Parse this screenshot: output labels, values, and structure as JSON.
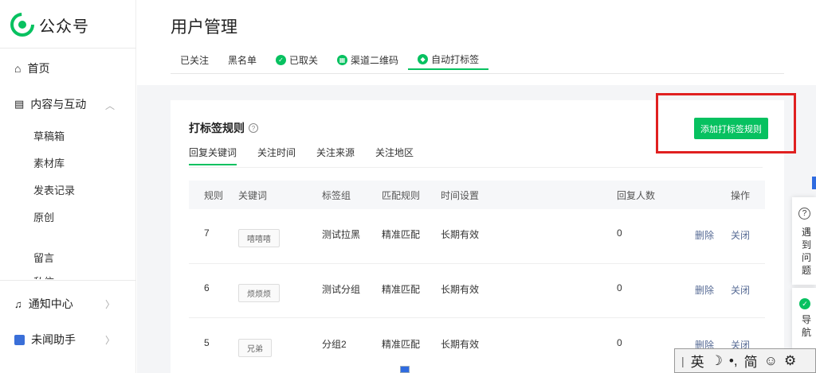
{
  "app": {
    "name": "公众号"
  },
  "sidebar": {
    "items": [
      {
        "label": "首页",
        "icon": "home-icon"
      },
      {
        "label": "内容与互动",
        "icon": "document-icon"
      },
      {
        "label": "通知中心",
        "icon": "bell-icon"
      },
      {
        "label": "未闻助手",
        "icon": "assistant-icon"
      }
    ],
    "sub_items": [
      "草稿箱",
      "素材库",
      "发表记录",
      "原创",
      "留言"
    ],
    "partial_item": "私信"
  },
  "page": {
    "title": "用户管理"
  },
  "tabs": [
    {
      "label": "已关注",
      "icon": ""
    },
    {
      "label": "黑名单",
      "icon": ""
    },
    {
      "label": "已取关",
      "icon": "check-icon"
    },
    {
      "label": "渠道二维码",
      "icon": "qrcode-icon"
    },
    {
      "label": "自动打标签",
      "icon": "tag-icon"
    }
  ],
  "rules": {
    "title": "打标签规则",
    "add_button": "添加打标签规则",
    "subtabs": [
      "回复关键词",
      "关注时间",
      "关注来源",
      "关注地区"
    ]
  },
  "table": {
    "headers": [
      "规则",
      "关键词",
      "标签组",
      "匹配规则",
      "时间设置",
      "回复人数",
      "操作"
    ],
    "rows": [
      {
        "rule": "7",
        "keyword": "嘻嘻嘻",
        "group": "测试拉黑",
        "match": "精准匹配",
        "time": "长期有效",
        "count": "0",
        "delete": "删除",
        "close": "关闭"
      },
      {
        "rule": "6",
        "keyword": "烦烦烦",
        "group": "测试分组",
        "match": "精准匹配",
        "time": "长期有效",
        "count": "0",
        "delete": "删除",
        "close": "关闭"
      },
      {
        "rule": "5",
        "keyword": "兄弟",
        "group": "分组2",
        "match": "精准匹配",
        "time": "长期有效",
        "count": "0",
        "delete": "删除",
        "close": "关闭"
      }
    ]
  },
  "helpers": {
    "problem": "遇到问题",
    "guide": "导航"
  },
  "ime": {
    "lang": "英",
    "mode": "简"
  },
  "colors": {
    "accent": "#07c160",
    "link": "#576b95",
    "highlight": "#e02020"
  }
}
